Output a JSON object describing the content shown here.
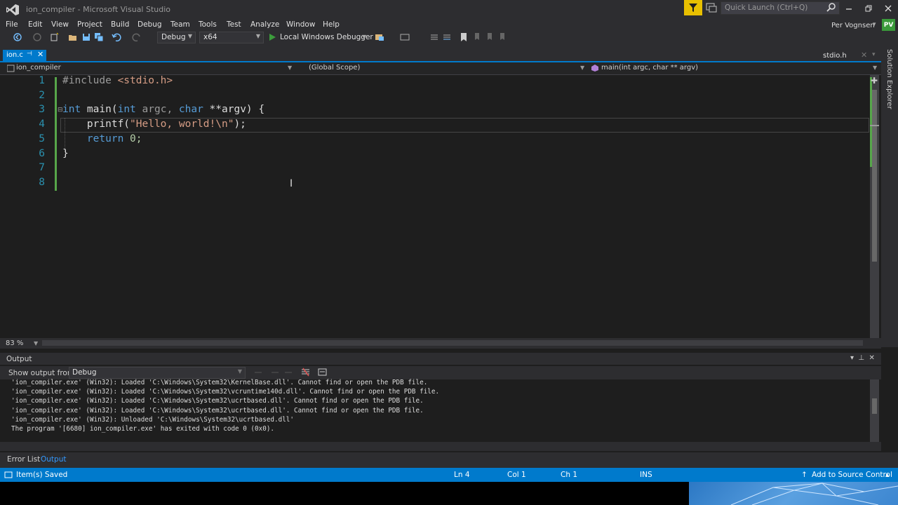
{
  "window": {
    "title": "ion_compiler - Microsoft Visual Studio",
    "quick_launch_placeholder": "Quick Launch (Ctrl+Q)",
    "user_name": "Per Vognsen",
    "user_initials": "PV"
  },
  "menu": [
    "File",
    "Edit",
    "View",
    "Project",
    "Build",
    "Debug",
    "Team",
    "Tools",
    "Test",
    "Analyze",
    "Window",
    "Help"
  ],
  "toolbar": {
    "configuration": "Debug",
    "platform": "x64",
    "debugger": "Local Windows Debugger"
  },
  "tabs": {
    "active": "ion.c",
    "other": "stdio.h"
  },
  "navbar": {
    "project": "ion_compiler",
    "scope": "(Global Scope)",
    "member": "main(int argc, char ** argv)"
  },
  "side_panel": "Solution Explorer",
  "editor": {
    "line_numbers": [
      "1",
      "2",
      "3",
      "4",
      "5",
      "6",
      "7",
      "8"
    ],
    "zoom": "83 %"
  },
  "output": {
    "title": "Output",
    "show_output_from_label": "Show output from:",
    "source": "Debug",
    "lines": [
      "'ion_compiler.exe' (Win32): Loaded 'C:\\Windows\\System32\\KernelBase.dll'. Cannot find or open the PDB file.",
      "'ion_compiler.exe' (Win32): Loaded 'C:\\Windows\\System32\\vcruntime140d.dll'. Cannot find or open the PDB file.",
      "'ion_compiler.exe' (Win32): Loaded 'C:\\Windows\\System32\\ucrtbased.dll'. Cannot find or open the PDB file.",
      "'ion_compiler.exe' (Win32): Loaded 'C:\\Windows\\System32\\ucrtbased.dll'. Cannot find or open the PDB file.",
      "'ion_compiler.exe' (Win32): Unloaded 'C:\\Windows\\System32\\ucrtbased.dll'",
      "The program '[6680] ion_compiler.exe' has exited with code 0 (0x0)."
    ]
  },
  "bottom_tabs": [
    "Error List",
    "Output"
  ],
  "status": {
    "message": "Item(s) Saved",
    "line": "Ln 4",
    "col": "Col 1",
    "ch": "Ch 1",
    "mode": "INS",
    "source_control": "Add to Source Control"
  },
  "colors": {
    "accent": "#007acc",
    "keyword": "#569cd6",
    "string": "#d69d85",
    "line_number": "#2b91af",
    "preprocessor": "#9b9b9b",
    "change_bar": "#57a64a"
  }
}
